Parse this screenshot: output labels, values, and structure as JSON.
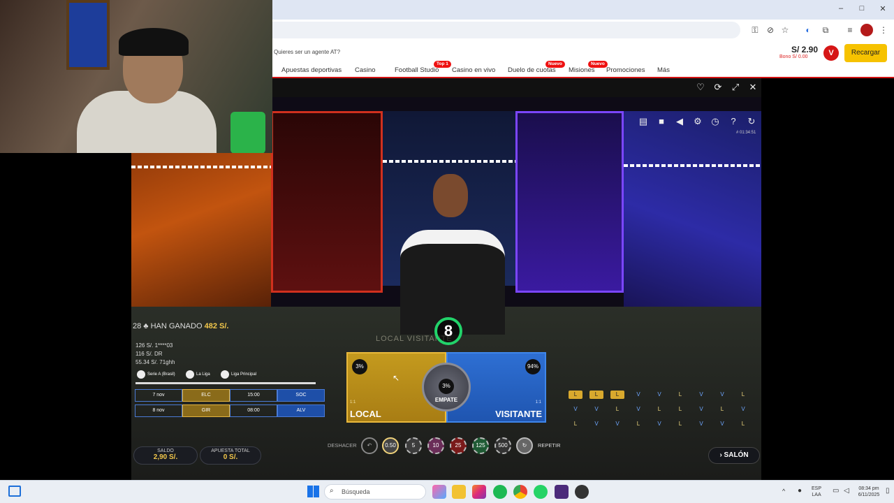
{
  "browser": {
    "window_controls": [
      "–",
      "□",
      "✕"
    ]
  },
  "site": {
    "agent_question": "Quieres ser un agente AT?",
    "nav": [
      {
        "label": "Apuestas deportivas"
      },
      {
        "label": "Casino"
      },
      {
        "label": "Football Studio",
        "badge": "Top 1"
      },
      {
        "label": "Casino en vivo"
      },
      {
        "label": "Duelo de cuotas",
        "badge": "Nuevo"
      },
      {
        "label": "Misiones",
        "badge": "Nuevo"
      },
      {
        "label": "Promociones"
      },
      {
        "label": "Más"
      }
    ],
    "balance": "S/ 2.90",
    "bono": "Bono S/ 0.00",
    "avatar_letter": "V",
    "recargar_label": "Recargar"
  },
  "game": {
    "timestamp": "# 01:34:51",
    "won_prefix": "28 ♣ HAN GANADO",
    "won_amount": "482 S/.",
    "winners": [
      "126 S/. 1****03",
      "116 S/. DR",
      "55.34 S/. 71ghh"
    ],
    "leagues": [
      "Serie A (Brasil)",
      "La Liga",
      "Liga Principal"
    ],
    "fixtures": [
      {
        "date": "7 nov",
        "home": "ELC",
        "time": "15:00",
        "away": "SOC"
      },
      {
        "date": "8 nov",
        "home": "GIR",
        "time": "08:00",
        "away": "ALV"
      }
    ],
    "table_text": "LOCAL    VISITANTE",
    "timer": "8",
    "local_pct": "3%",
    "visit_pct": "94%",
    "empate_pct": "3%",
    "empate_label": "EMPATE",
    "local_label": "LOCAL",
    "visit_label": "VISITANTE",
    "payout": "1:1",
    "roadmap": [
      [
        "L",
        "L",
        "L",
        "V",
        "V",
        "L",
        "V",
        "V",
        "L"
      ],
      [
        "V",
        "V",
        "L",
        "V",
        "L",
        "L",
        "V",
        "L",
        "V"
      ],
      [
        "L",
        "V",
        "V",
        "L",
        "V",
        "L",
        "V",
        "V",
        "L"
      ]
    ],
    "deshacer_label": "DESHACER",
    "chips": [
      "0.50",
      "5",
      "10",
      "25",
      "125",
      "500"
    ],
    "repetir_label": "REPETIR",
    "saldo_label": "SALDO",
    "saldo_value": "2,90 S/.",
    "apuesta_label": "APUESTA TOTAL",
    "apuesta_value": "0 S/.",
    "salon_label": "SALÓN"
  },
  "taskbar": {
    "search_placeholder": "Búsqueda",
    "lang": "ESP",
    "lang2": "LAA",
    "time": "08:34 pm",
    "date": "6/11/2025"
  }
}
